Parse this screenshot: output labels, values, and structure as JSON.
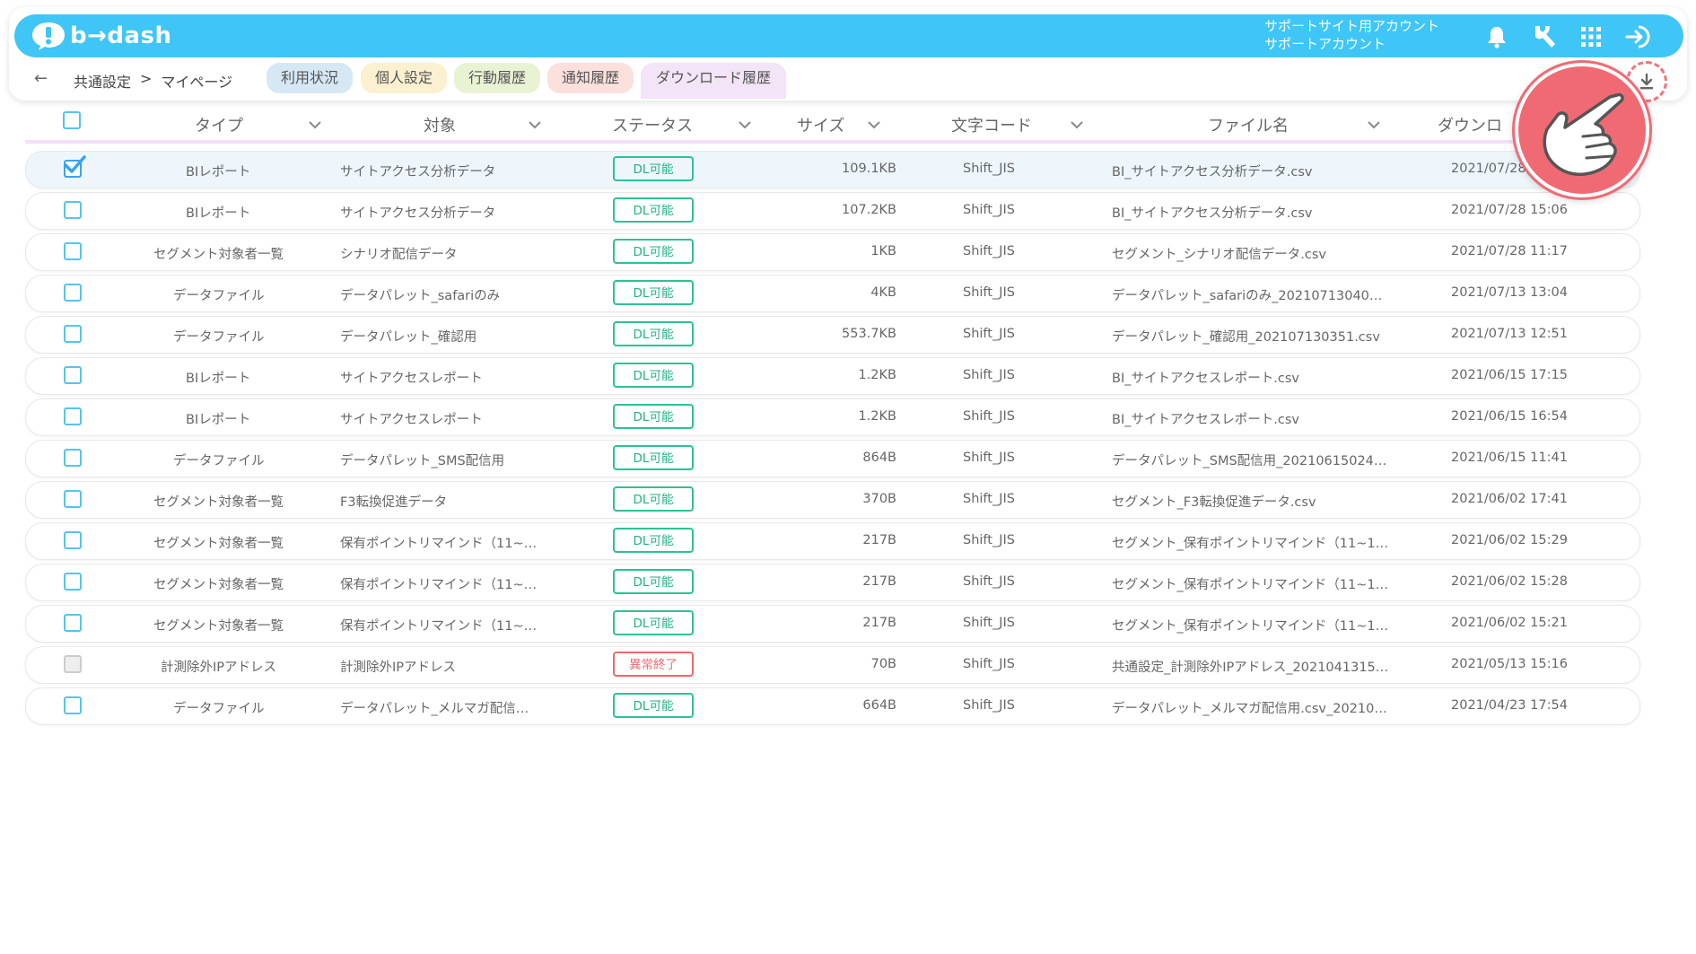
{
  "app": {
    "logo_text": "b→dash",
    "account_line1": "サポートサイト用アカウント",
    "account_line2": "サポートアカウント",
    "accent_color": "#3fc6f6"
  },
  "nav": {
    "breadcrumb_root": "共通設定",
    "breadcrumb_sep": ">",
    "breadcrumb_current": "マイページ",
    "tabs": [
      {
        "label": "利用状況",
        "bg": "#d6e8f4"
      },
      {
        "label": "個人設定",
        "bg": "#fbf0cf"
      },
      {
        "label": "行動履歴",
        "bg": "#e9f3d4"
      },
      {
        "label": "通知履歴",
        "bg": "#fbe0dd"
      },
      {
        "label": "ダウンロード履歴",
        "bg": "#f3e4f7",
        "active": true
      }
    ]
  },
  "table": {
    "columns": [
      "タイプ",
      "対象",
      "ステータス",
      "サイズ",
      "文字コード",
      "ファイル名",
      "ダウンロ"
    ],
    "rows": [
      {
        "type": "BIレポート",
        "target": "サイトアクセス分析データ",
        "status": "DL可能",
        "size": "109.1KB",
        "encoding": "Shift_JIS",
        "filename": "BI_サイトアクセス分析データ.csv",
        "date": "2021/07/28",
        "checked": true
      },
      {
        "type": "BIレポート",
        "target": "サイトアクセス分析データ",
        "status": "DL可能",
        "size": "107.2KB",
        "encoding": "Shift_JIS",
        "filename": "BI_サイトアクセス分析データ.csv",
        "date": "2021/07/28 15:06"
      },
      {
        "type": "セグメント対象者一覧",
        "target": "シナリオ配信データ",
        "status": "DL可能",
        "size": "1KB",
        "encoding": "Shift_JIS",
        "filename": "セグメント_シナリオ配信データ.csv",
        "date": "2021/07/28 11:17"
      },
      {
        "type": "データファイル",
        "target": "データパレット_safariのみ",
        "status": "DL可能",
        "size": "4KB",
        "encoding": "Shift_JIS",
        "filename": "データパレット_safariのみ_20210713040…",
        "date": "2021/07/13 13:04"
      },
      {
        "type": "データファイル",
        "target": "データパレット_確認用",
        "status": "DL可能",
        "size": "553.7KB",
        "encoding": "Shift_JIS",
        "filename": "データパレット_確認用_202107130351.csv",
        "date": "2021/07/13 12:51"
      },
      {
        "type": "BIレポート",
        "target": "サイトアクセスレポート",
        "status": "DL可能",
        "size": "1.2KB",
        "encoding": "Shift_JIS",
        "filename": "BI_サイトアクセスレポート.csv",
        "date": "2021/06/15 17:15"
      },
      {
        "type": "BIレポート",
        "target": "サイトアクセスレポート",
        "status": "DL可能",
        "size": "1.2KB",
        "encoding": "Shift_JIS",
        "filename": "BI_サイトアクセスレポート.csv",
        "date": "2021/06/15 16:54"
      },
      {
        "type": "データファイル",
        "target": "データパレット_SMS配信用",
        "status": "DL可能",
        "size": "864B",
        "encoding": "Shift_JIS",
        "filename": "データパレット_SMS配信用_20210615024…",
        "date": "2021/06/15 11:41"
      },
      {
        "type": "セグメント対象者一覧",
        "target": "F3転換促進データ",
        "status": "DL可能",
        "size": "370B",
        "encoding": "Shift_JIS",
        "filename": "セグメント_F3転換促進データ.csv",
        "date": "2021/06/02 17:41"
      },
      {
        "type": "セグメント対象者一覧",
        "target": "保有ポイントリマインド（11~…",
        "status": "DL可能",
        "size": "217B",
        "encoding": "Shift_JIS",
        "filename": "セグメント_保有ポイントリマインド（11~1…",
        "date": "2021/06/02 15:29"
      },
      {
        "type": "セグメント対象者一覧",
        "target": "保有ポイントリマインド（11~…",
        "status": "DL可能",
        "size": "217B",
        "encoding": "Shift_JIS",
        "filename": "セグメント_保有ポイントリマインド（11~1…",
        "date": "2021/06/02 15:28"
      },
      {
        "type": "セグメント対象者一覧",
        "target": "保有ポイントリマインド（11~…",
        "status": "DL可能",
        "size": "217B",
        "encoding": "Shift_JIS",
        "filename": "セグメント_保有ポイントリマインド（11~1…",
        "date": "2021/06/02 15:21"
      },
      {
        "type": "計測除外IPアドレス",
        "target": "計測除外IPアドレス",
        "status": "異常終了",
        "size": "70B",
        "encoding": "Shift_JIS",
        "filename": "共通設定_計測除外IPアドレス_2021041315…",
        "date": "2021/05/13 15:16",
        "disabled": true,
        "error": true
      },
      {
        "type": "データファイル",
        "target": "データパレット_メルマガ配信…",
        "status": "DL可能",
        "size": "664B",
        "encoding": "Shift_JIS",
        "filename": "データパレット_メルマガ配信用.csv_20210…",
        "date": "2021/04/23 17:54"
      }
    ]
  }
}
